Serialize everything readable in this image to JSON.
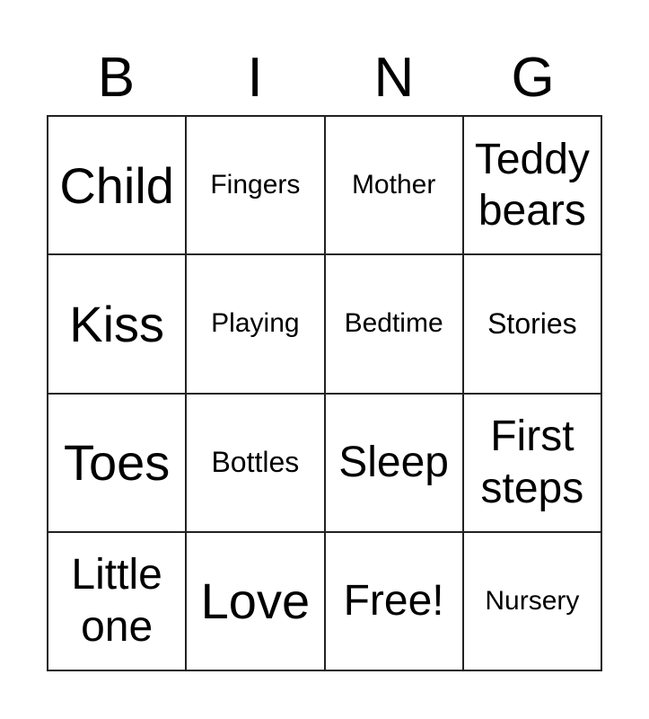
{
  "header": [
    "B",
    "I",
    "N",
    "G"
  ],
  "cells": [
    {
      "text": "Child",
      "size": "xl"
    },
    {
      "text": "Fingers",
      "size": "xs"
    },
    {
      "text": "Mother",
      "size": "xs"
    },
    {
      "text": "Teddy bears",
      "size": "lg"
    },
    {
      "text": "Kiss",
      "size": "xl"
    },
    {
      "text": "Playing",
      "size": "xs"
    },
    {
      "text": "Bedtime",
      "size": "xs"
    },
    {
      "text": "Stories",
      "size": "sm"
    },
    {
      "text": "Toes",
      "size": "xl"
    },
    {
      "text": "Bottles",
      "size": "sm"
    },
    {
      "text": "Sleep",
      "size": "lg"
    },
    {
      "text": "First steps",
      "size": "lg"
    },
    {
      "text": "Little one",
      "size": "lg"
    },
    {
      "text": "Love",
      "size": "xl"
    },
    {
      "text": "Free!",
      "size": "lg"
    },
    {
      "text": "Nursery",
      "size": "xs"
    }
  ]
}
